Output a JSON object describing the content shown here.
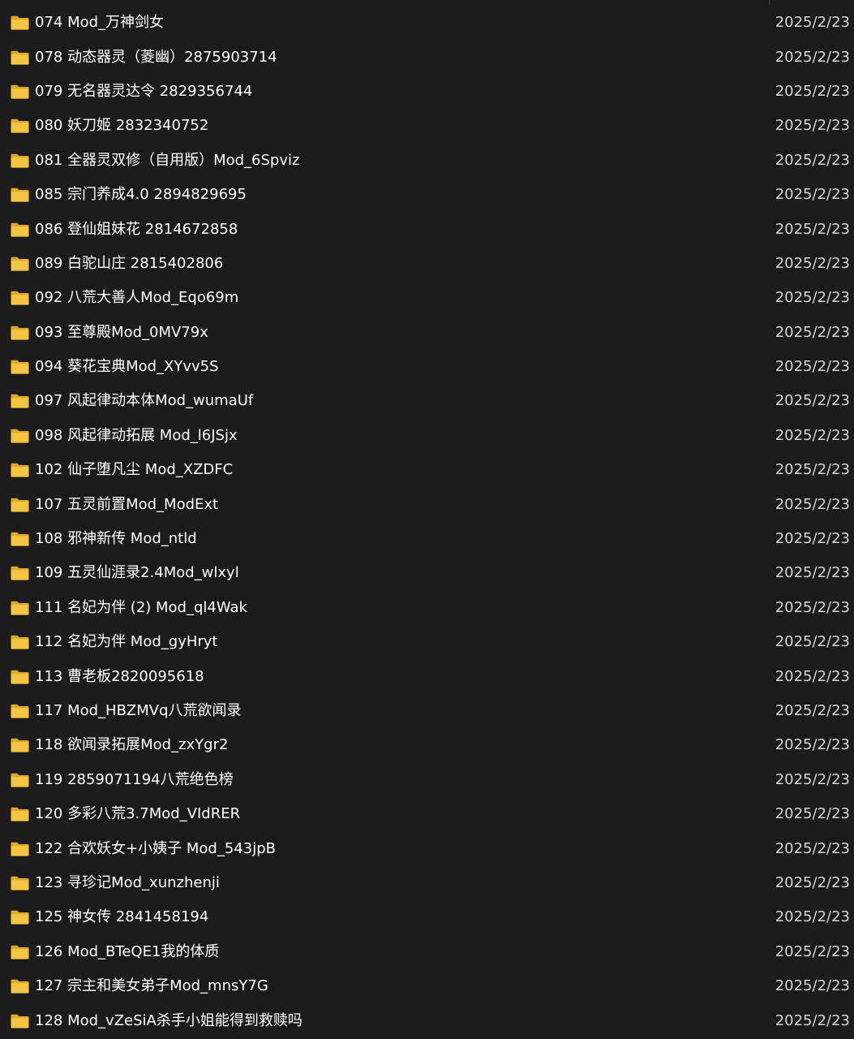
{
  "colors": {
    "background": "#1c1c1c",
    "folder_body": "#f4c542",
    "folder_tab": "#e1a826"
  },
  "icon": "folder-icon",
  "rows": [
    {
      "name": "074 Mod_万神剑女",
      "date": "2025/2/23"
    },
    {
      "name": "078 动态器灵（菱幽）2875903714",
      "date": "2025/2/23"
    },
    {
      "name": "079 无名器灵达令 2829356744",
      "date": "2025/2/23"
    },
    {
      "name": "080 妖刀姬 2832340752",
      "date": "2025/2/23"
    },
    {
      "name": "081 全器灵双修（自用版）Mod_6Spviz",
      "date": "2025/2/23"
    },
    {
      "name": "085 宗门养成4.0 2894829695",
      "date": "2025/2/23"
    },
    {
      "name": "086 登仙姐妹花 2814672858",
      "date": "2025/2/23"
    },
    {
      "name": "089 白驼山庄 2815402806",
      "date": "2025/2/23"
    },
    {
      "name": "092 八荒大善人Mod_Eqo69m",
      "date": "2025/2/23"
    },
    {
      "name": "093 至尊殿Mod_0MV79x",
      "date": "2025/2/23"
    },
    {
      "name": "094 葵花宝典Mod_XYvv5S",
      "date": "2025/2/23"
    },
    {
      "name": "097 风起律动本体Mod_wumaUf",
      "date": "2025/2/23"
    },
    {
      "name": "098 风起律动拓展 Mod_l6JSjx",
      "date": "2025/2/23"
    },
    {
      "name": "102 仙子堕凡尘 Mod_XZDFC",
      "date": "2025/2/23"
    },
    {
      "name": "107 五灵前置Mod_ModExt",
      "date": "2025/2/23"
    },
    {
      "name": "108 邪神新传 Mod_ntld",
      "date": "2025/2/23"
    },
    {
      "name": "109 五灵仙涯录2.4Mod_wlxyl",
      "date": "2025/2/23"
    },
    {
      "name": "111 名妃为伴 (2) Mod_ql4Wak",
      "date": "2025/2/23"
    },
    {
      "name": "112 名妃为伴 Mod_gyHryt",
      "date": "2025/2/23"
    },
    {
      "name": "113 曹老板2820095618",
      "date": "2025/2/23"
    },
    {
      "name": "117 Mod_HBZMVq八荒欲闻录",
      "date": "2025/2/23"
    },
    {
      "name": "118 欲闻录拓展Mod_zxYgr2",
      "date": "2025/2/23"
    },
    {
      "name": "119 2859071194八荒绝色榜",
      "date": "2025/2/23"
    },
    {
      "name": "120 多彩八荒3.7Mod_VIdRER",
      "date": "2025/2/23"
    },
    {
      "name": "122 合欢妖女+小姨子 Mod_543jpB",
      "date": "2025/2/23"
    },
    {
      "name": "123 寻珍记Mod_xunzhenji",
      "date": "2025/2/23"
    },
    {
      "name": "125 神女传 2841458194",
      "date": "2025/2/23"
    },
    {
      "name": "126 Mod_BTeQE1我的体质",
      "date": "2025/2/23"
    },
    {
      "name": "127 宗主和美女弟子Mod_mnsY7G",
      "date": "2025/2/23"
    },
    {
      "name": "128 Mod_vZeSiA杀手小姐能得到救赎吗",
      "date": "2025/2/23"
    }
  ]
}
